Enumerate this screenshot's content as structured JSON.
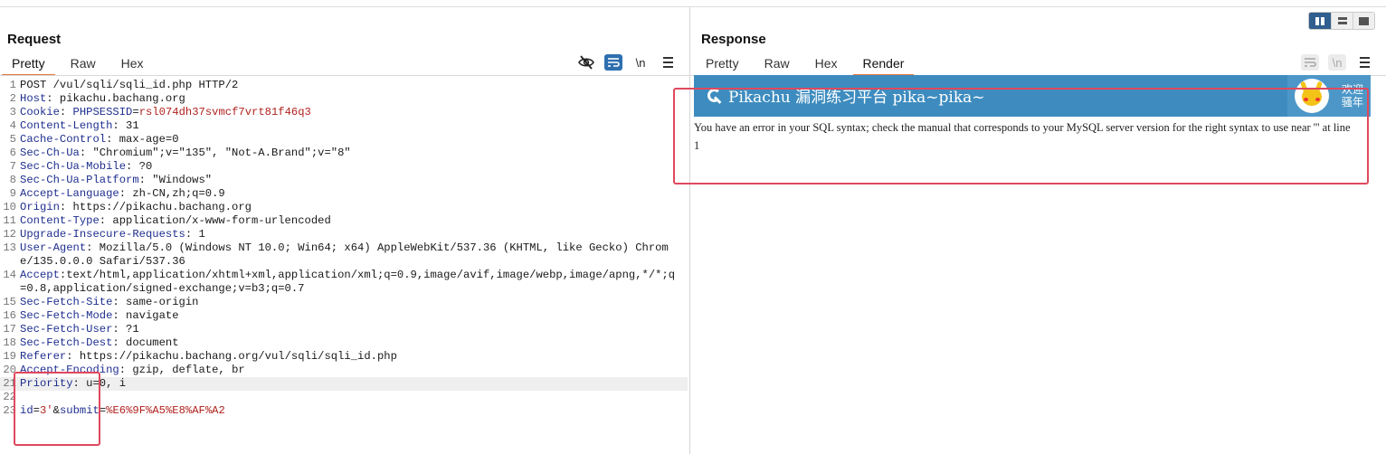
{
  "layout_toggles": [
    {
      "name": "split-vertical"
    },
    {
      "name": "split-horizontal"
    },
    {
      "name": "single"
    }
  ],
  "request": {
    "title": "Request",
    "tabs": [
      "Pretty",
      "Raw",
      "Hex"
    ],
    "active_tab": "Pretty",
    "tools": {
      "newline_label": "\\n"
    },
    "lines": [
      {
        "n": "1",
        "key": "",
        "sep": "",
        "value": "POST /vul/sqli/sqli_id.php HTTP/2"
      },
      {
        "n": "2",
        "key": "Host",
        "sep": ": ",
        "value": "pikachu.bachang.org"
      },
      {
        "n": "3",
        "key": "Cookie",
        "sep": ": ",
        "value": "",
        "cookie_name": "PHPSESSID",
        "cookie_value": "rsl074dh37svmcf7vrt81f46q3"
      },
      {
        "n": "4",
        "key": "Content-Length",
        "sep": ": ",
        "value": "31"
      },
      {
        "n": "5",
        "key": "Cache-Control",
        "sep": ": ",
        "value": "max-age=0"
      },
      {
        "n": "6",
        "key": "Sec-Ch-Ua",
        "sep": ": ",
        "value": "\"Chromium\";v=\"135\", \"Not-A.Brand\";v=\"8\""
      },
      {
        "n": "7",
        "key": "Sec-Ch-Ua-Mobile",
        "sep": ": ",
        "value": "?0"
      },
      {
        "n": "8",
        "key": "Sec-Ch-Ua-Platform",
        "sep": ": ",
        "value": "\"Windows\""
      },
      {
        "n": "9",
        "key": "Accept-Language",
        "sep": ": ",
        "value": "zh-CN,zh;q=0.9"
      },
      {
        "n": "10",
        "key": "Origin",
        "sep": ": ",
        "value": "https://pikachu.bachang.org"
      },
      {
        "n": "11",
        "key": "Content-Type",
        "sep": ": ",
        "value": "application/x-www-form-urlencoded"
      },
      {
        "n": "12",
        "key": "Upgrade-Insecure-Requests",
        "sep": ": ",
        "value": "1"
      },
      {
        "n": "13",
        "key": "User-Agent",
        "sep": ": ",
        "value": "Mozilla/5.0 (Windows NT 10.0; Win64; x64) AppleWebKit/537.36 (KHTML, like Gecko) Chrome/135.0.0.0 Safari/537.36"
      },
      {
        "n": "14",
        "key": "Accept",
        "sep": ":",
        "value": "text/html,application/xhtml+xml,application/xml;q=0.9,image/avif,image/webp,image/apng,*/*;q=0.8,application/signed-exchange;v=b3;q=0.7"
      },
      {
        "n": "15",
        "key": "Sec-Fetch-Site",
        "sep": ": ",
        "value": "same-origin"
      },
      {
        "n": "16",
        "key": "Sec-Fetch-Mode",
        "sep": ": ",
        "value": "navigate"
      },
      {
        "n": "17",
        "key": "Sec-Fetch-User",
        "sep": ": ",
        "value": "?1"
      },
      {
        "n": "18",
        "key": "Sec-Fetch-Dest",
        "sep": ": ",
        "value": "document"
      },
      {
        "n": "19",
        "key": "Referer",
        "sep": ": ",
        "value": "https://pikachu.bachang.org/vul/sqli/sqli_id.php"
      },
      {
        "n": "20",
        "key": "Accept-Encoding",
        "sep": ": ",
        "value": "gzip, deflate, br"
      },
      {
        "n": "21",
        "key": "Priority",
        "sep": ": ",
        "value": "u=0, i"
      },
      {
        "n": "22",
        "key": "",
        "sep": "",
        "value": ""
      },
      {
        "n": "23",
        "key": "",
        "sep": "",
        "value": "",
        "body_params": [
          {
            "k": "id",
            "v": "3'"
          },
          {
            "k": "submit",
            "v": "%E6%9F%A5%E8%AF%A2"
          }
        ]
      }
    ]
  },
  "response": {
    "title": "Response",
    "tabs": [
      "Pretty",
      "Raw",
      "Hex",
      "Render"
    ],
    "active_tab": "Render",
    "tools": {
      "newline_label": "\\n"
    },
    "render": {
      "site_title": "Pikachu 漏洞练习平台 pika~pika~",
      "greeting_line1": "欢迎",
      "greeting_line2": "骚年",
      "error_text": "You have an error in your SQL syntax; check the manual that corresponds to your MySQL server version for the right syntax to use near ''' at line 1"
    }
  },
  "colors": {
    "accent_tab": "#e8773a",
    "header_key": "#1f2f8f",
    "cookie_value": "#b0221e",
    "render_bar": "#3e8cbf",
    "annotation_box": "#e0485e"
  }
}
